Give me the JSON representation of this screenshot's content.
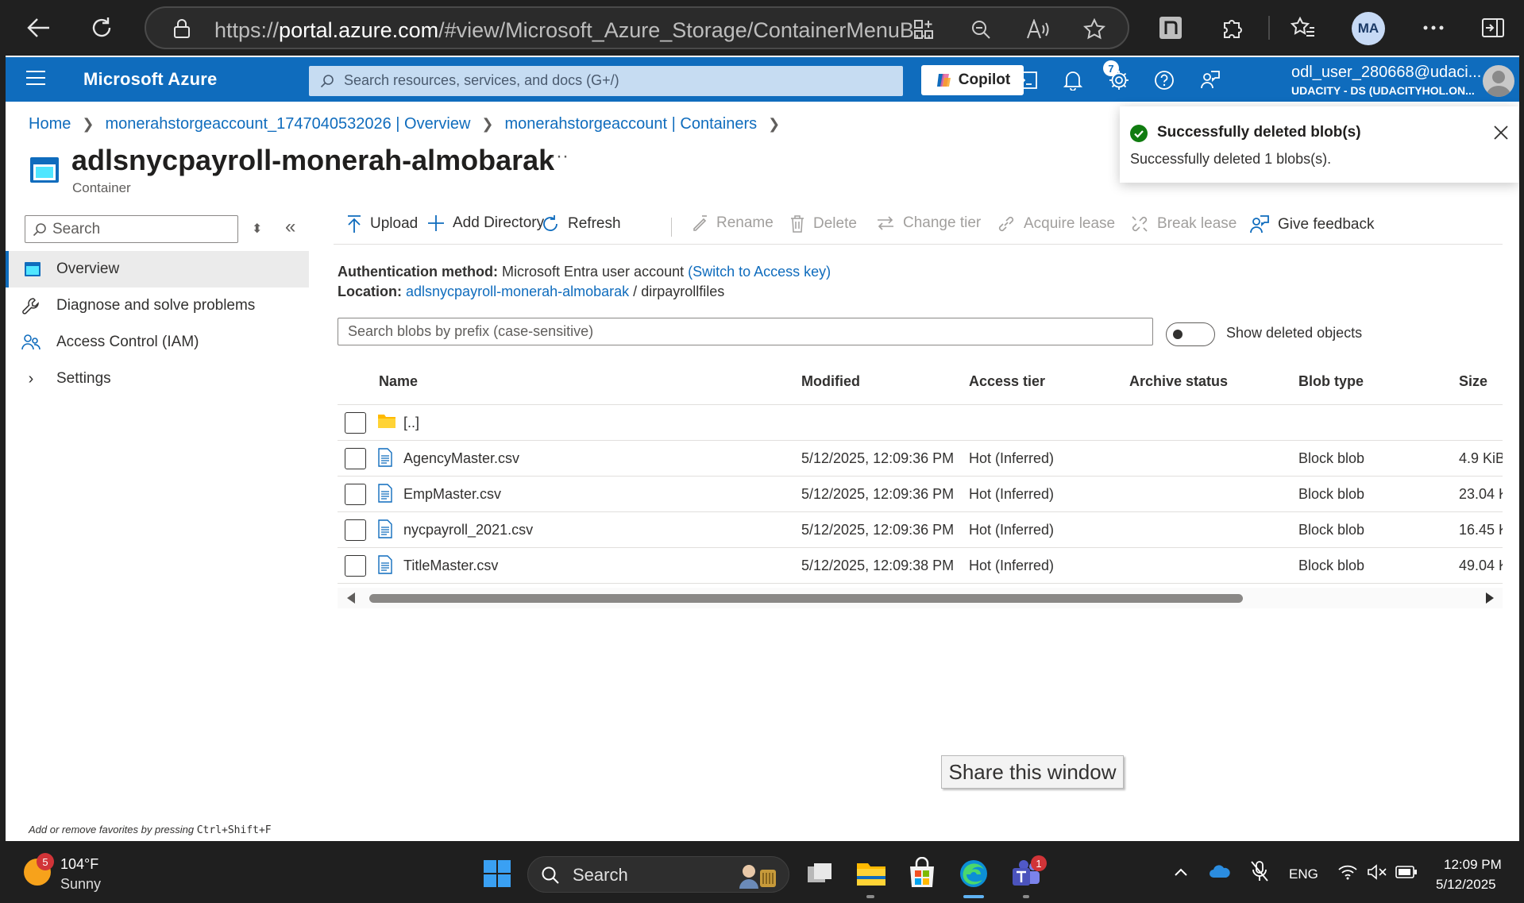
{
  "browser": {
    "url_prefix": "https://",
    "url_domain": "portal.azure.com",
    "url_path": "/#view/Microsoft_Azure_Storage/ContainerMenuB...",
    "profile_initials": "MA"
  },
  "portal": {
    "brand": "Microsoft Azure",
    "search_placeholder": "Search resources, services, and docs (G+/)",
    "copilot_label": "Copilot",
    "notification_count": "7",
    "user_email": "odl_user_280668@udaci...",
    "user_tenant": "UDACITY - DS (UDACITYHOL.ON..."
  },
  "breadcrumb": [
    "Home",
    "monerahstorgeaccount_1747040532026 | Overview",
    "monerahstorgeaccount | Containers"
  ],
  "resource": {
    "title": "adlsnycpayroll-monerah-almobarak",
    "type": "Container",
    "more": "···"
  },
  "toast": {
    "title": "Successfully deleted blob(s)",
    "body": "Successfully deleted 1 blobs(s)."
  },
  "nav": {
    "search_placeholder": "Search",
    "items": [
      "Overview",
      "Diagnose and solve problems",
      "Access Control (IAM)",
      "Settings"
    ],
    "footer_text": "Add or remove favorites by pressing ",
    "footer_keys": "Ctrl+Shift+F"
  },
  "commands": {
    "upload": "Upload",
    "add_directory": "Add Directory",
    "refresh": "Refresh",
    "rename": "Rename",
    "delete": "Delete",
    "change_tier": "Change tier",
    "acquire_lease": "Acquire lease",
    "break_lease": "Break lease",
    "give_feedback": "Give feedback"
  },
  "info": {
    "auth_label": "Authentication method:",
    "auth_value": "Microsoft Entra user account",
    "auth_link": "(Switch to Access key)",
    "location_label": "Location:",
    "location_link": "adlsnycpayroll-monerah-almobarak",
    "location_sep": "/",
    "location_folder": "dirpayrollfiles"
  },
  "blob_search_placeholder": "Search blobs by prefix (case-sensitive)",
  "show_deleted_label": "Show deleted objects",
  "table": {
    "columns": [
      "Name",
      "Modified",
      "Access tier",
      "Archive status",
      "Blob type",
      "Size"
    ],
    "parent_row": "[..]",
    "rows": [
      {
        "name": "AgencyMaster.csv",
        "modified": "5/12/2025, 12:09:36 PM",
        "tier": "Hot (Inferred)",
        "archive": "",
        "type": "Block blob",
        "size": "4.9 KiB"
      },
      {
        "name": "EmpMaster.csv",
        "modified": "5/12/2025, 12:09:36 PM",
        "tier": "Hot (Inferred)",
        "archive": "",
        "type": "Block blob",
        "size": "23.04 K"
      },
      {
        "name": "nycpayroll_2021.csv",
        "modified": "5/12/2025, 12:09:36 PM",
        "tier": "Hot (Inferred)",
        "archive": "",
        "type": "Block blob",
        "size": "16.45 K"
      },
      {
        "name": "TitleMaster.csv",
        "modified": "5/12/2025, 12:09:38 PM",
        "tier": "Hot (Inferred)",
        "archive": "",
        "type": "Block blob",
        "size": "49.04 K"
      }
    ]
  },
  "share_window_label": "Share this window",
  "taskbar": {
    "weather_temp": "104°F",
    "weather_cond": "Sunny",
    "weather_badge": "5",
    "search_label": "Search",
    "teams_badge": "1",
    "lang": "ENG",
    "time": "12:09 PM",
    "date": "5/12/2025"
  },
  "colors": {
    "azure_blue": "#0f6cbd",
    "success_green": "#107c10",
    "taskbar_bg": "#1f1f1f"
  }
}
